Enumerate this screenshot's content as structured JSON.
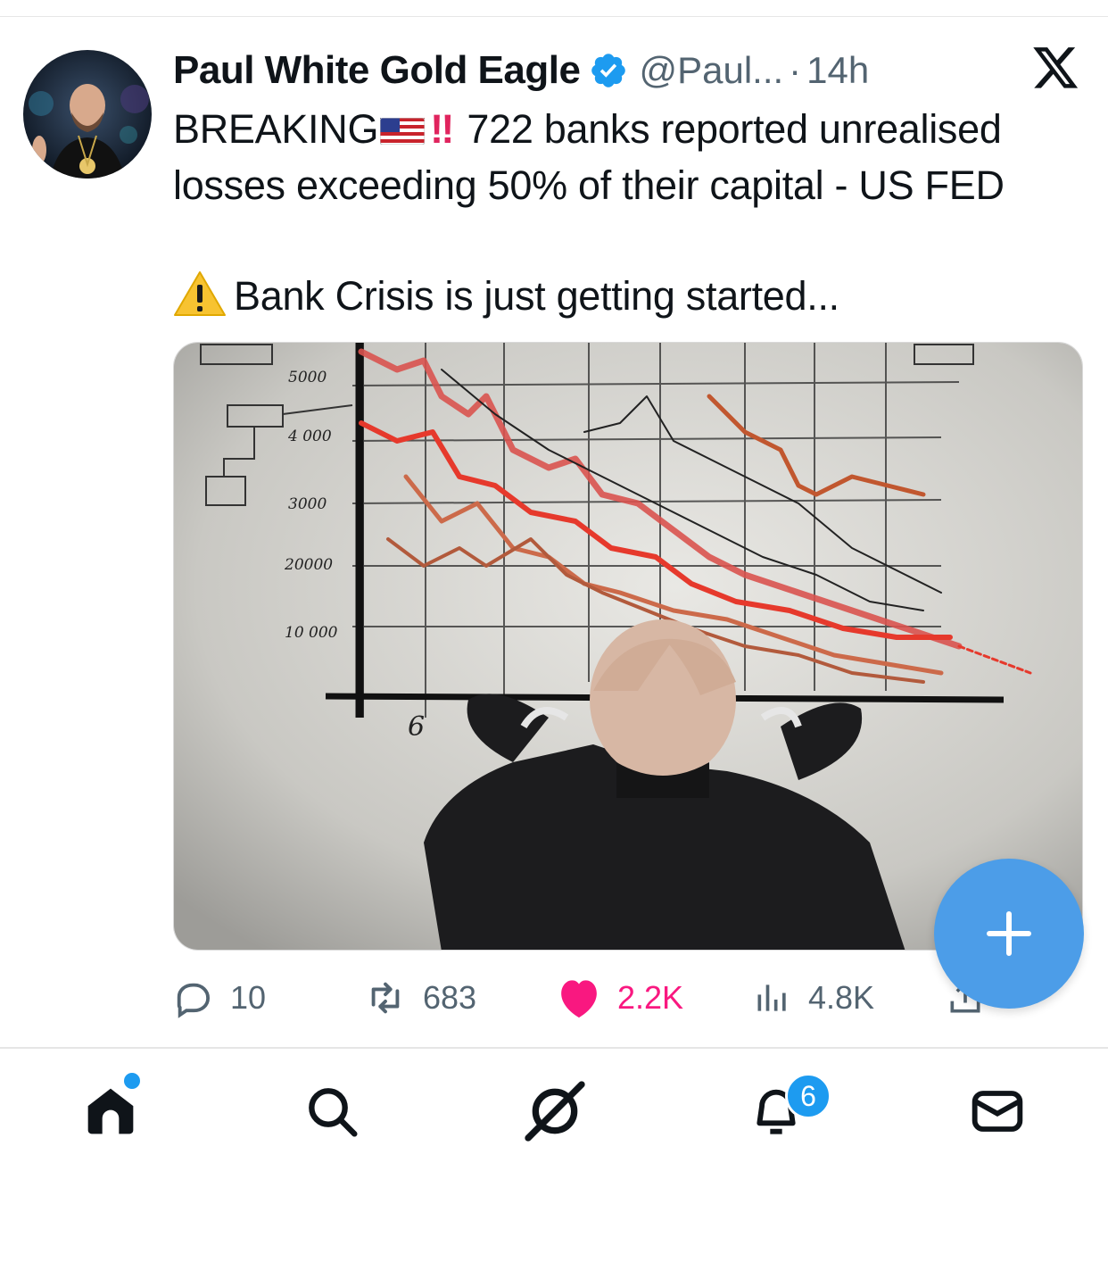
{
  "tweet": {
    "author": {
      "display_name": "Paul White Gold Eagle",
      "handle": "@Paul...",
      "verified": true,
      "avatar_icon": "avatar-photo"
    },
    "separator": "·",
    "time": "14h",
    "platform_icon": "x-logo-icon",
    "text": {
      "line1_prefix": "BREAKING",
      "flag_icon": "us-flag-emoji",
      "exclaim": "‼",
      "line1_rest": "722 banks reported unrealised",
      "line2": "losses exceeding 50% of their capital - US FED",
      "warning_icon": "warning-emoji",
      "line3": "Bank Crisis is just getting started..."
    },
    "media": {
      "image_icon": "falling-chart-man-holding-head-photo",
      "sketch_labels": [
        "5000",
        "4 000",
        "3000",
        "20000",
        "10 000",
        "6"
      ]
    },
    "stats": {
      "replies": "10",
      "reposts": "683",
      "likes": "2.2K",
      "views": "4.8K"
    }
  },
  "compose_button": {
    "icon": "plus-icon"
  },
  "tabbar": {
    "items": [
      {
        "name": "home",
        "icon": "home-icon",
        "active": true
      },
      {
        "name": "search",
        "icon": "search-icon"
      },
      {
        "name": "grok",
        "icon": "grok-icon"
      },
      {
        "name": "notifications",
        "icon": "bell-icon",
        "badge": "6"
      },
      {
        "name": "messages",
        "icon": "mail-icon"
      }
    ]
  },
  "colors": {
    "accent": "#1d9bf0",
    "like": "#f91880",
    "muted": "#536471",
    "fab": "#4c9de8"
  }
}
